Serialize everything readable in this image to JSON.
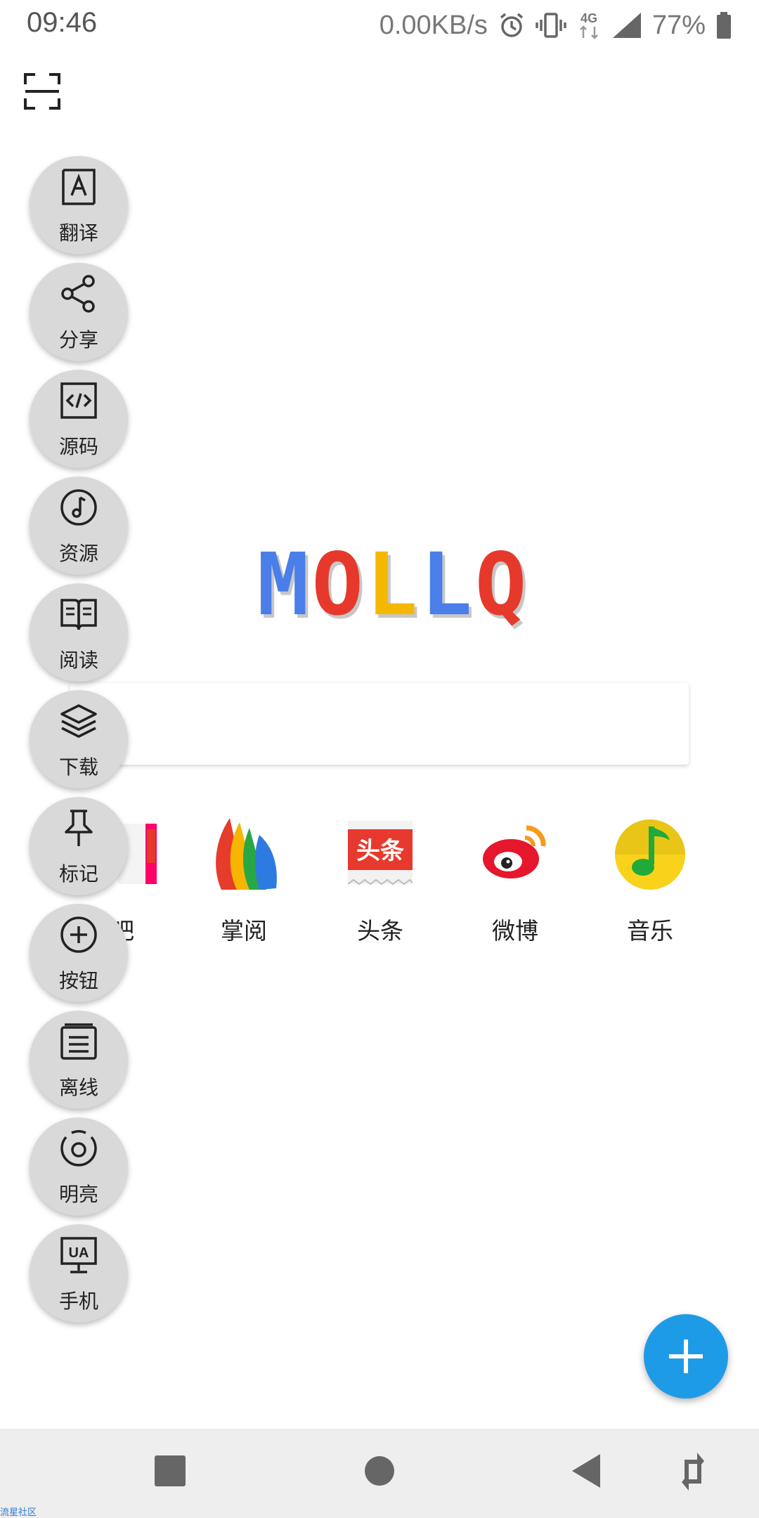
{
  "status_bar": {
    "time": "09:46",
    "net_speed": "0.00KB/s",
    "network_type": "4G",
    "battery": "77%",
    "icons": [
      "alarm-icon",
      "vibrate-icon",
      "4g-data-icon",
      "signal-icon",
      "battery-icon"
    ]
  },
  "top_left": {
    "icon": "scan-icon"
  },
  "logo": {
    "letters": [
      "M",
      "O",
      "L",
      "L",
      "Q"
    ],
    "colors": [
      "#4a7ee8",
      "#e6392c",
      "#f5b800",
      "#4a7ee8",
      "#e6392c"
    ]
  },
  "search": {
    "placeholder": ""
  },
  "shortcuts": [
    {
      "label": "吧",
      "icon": "tieba-icon"
    },
    {
      "label": "掌阅",
      "icon": "zhangyue-icon"
    },
    {
      "label": "头条",
      "icon": "toutiao-icon",
      "icon_text": "头条"
    },
    {
      "label": "微博",
      "icon": "weibo-icon"
    },
    {
      "label": "音乐",
      "icon": "qq-music-icon"
    }
  ],
  "side_menu": [
    {
      "label": "翻译",
      "icon": "translate-icon"
    },
    {
      "label": "分享",
      "icon": "share-icon"
    },
    {
      "label": "源码",
      "icon": "source-code-icon"
    },
    {
      "label": "资源",
      "icon": "music-resource-icon"
    },
    {
      "label": "阅读",
      "icon": "book-icon"
    },
    {
      "label": "下载",
      "icon": "layers-icon"
    },
    {
      "label": "标记",
      "icon": "pin-icon"
    },
    {
      "label": "按钮",
      "icon": "add-circle-icon"
    },
    {
      "label": "离线",
      "icon": "offline-icon"
    },
    {
      "label": "明亮",
      "icon": "brightness-icon"
    },
    {
      "label": "手机",
      "icon": "ua-monitor-icon",
      "icon_text": "UA"
    }
  ],
  "fab": {
    "icon": "plus-icon"
  },
  "nav_bar": {
    "buttons": [
      "recents-icon",
      "home-icon",
      "back-icon",
      "rotate-icon"
    ]
  },
  "watermark": "流星社区",
  "colors": {
    "accent": "#1e9be6",
    "side_button": "#d9d9d9",
    "nav_bg": "#eeeeee"
  }
}
